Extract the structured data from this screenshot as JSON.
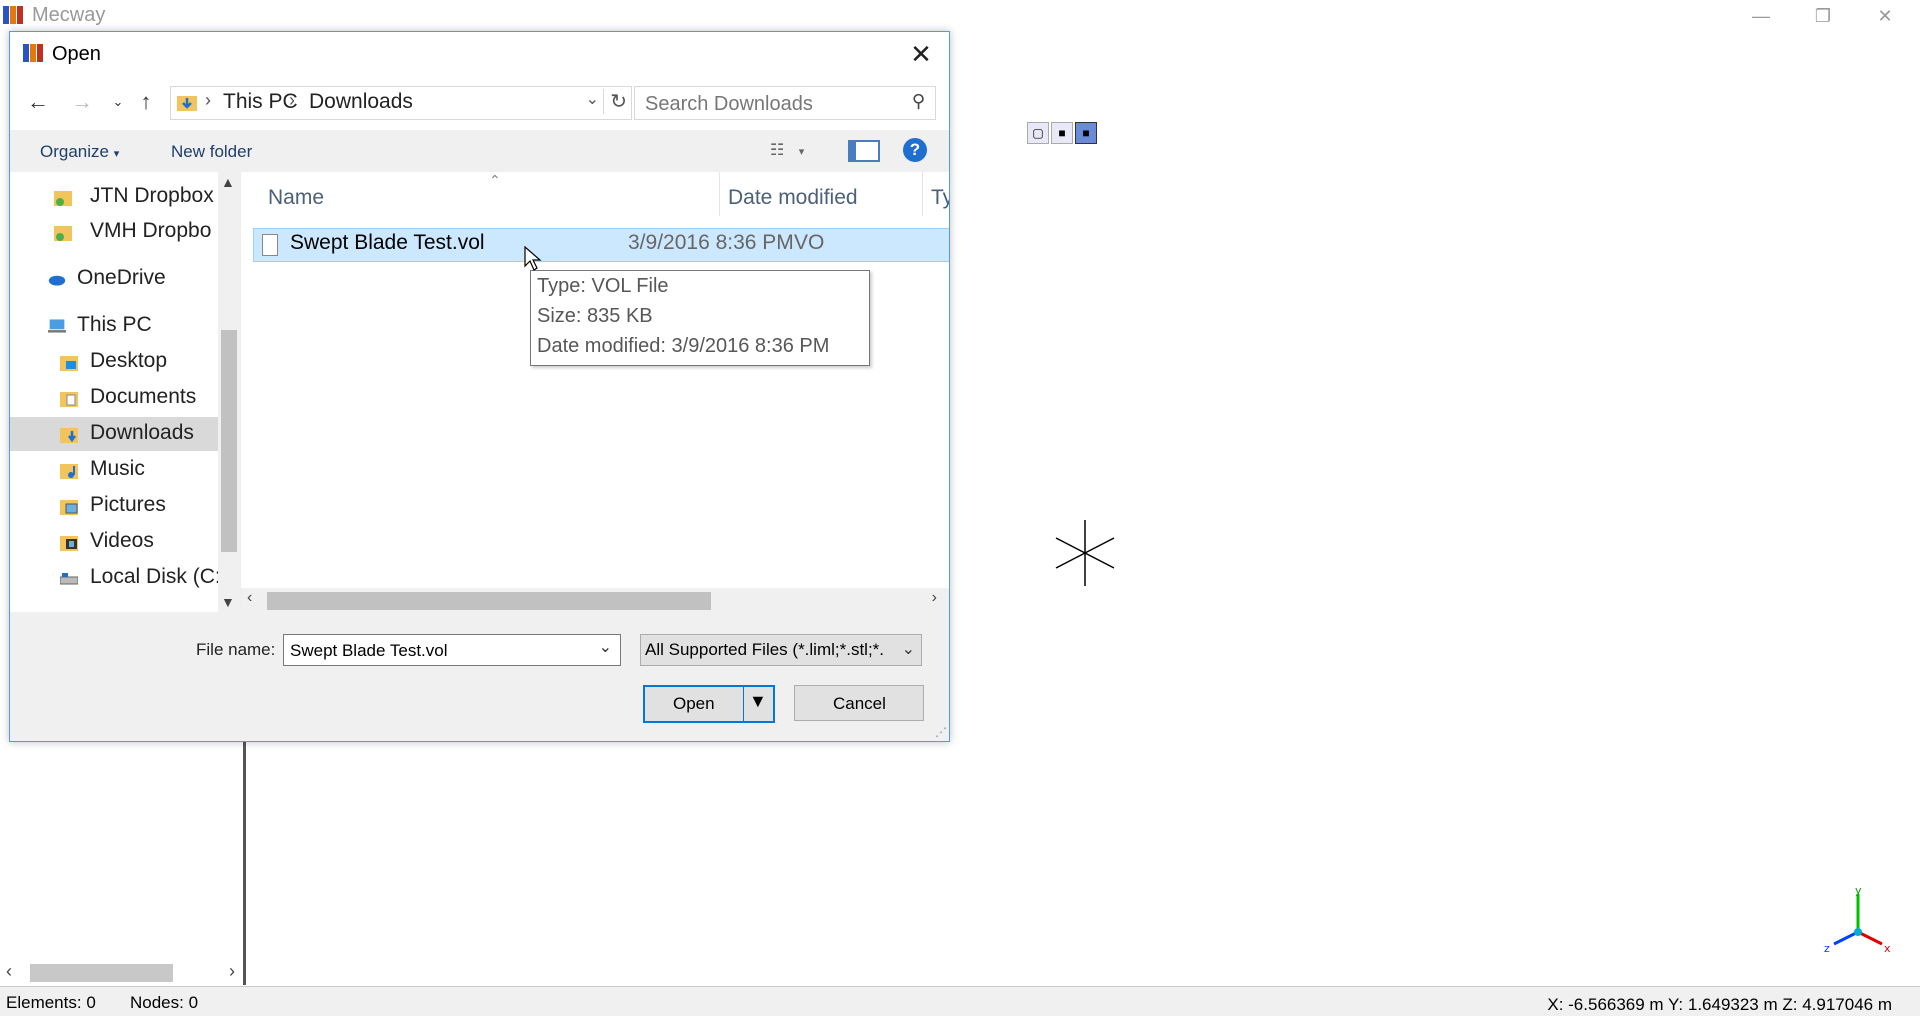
{
  "app": {
    "title": "Mecway",
    "status": {
      "elements_label": "Elements:",
      "elements_value": "0",
      "nodes_label": "Nodes:",
      "nodes_value": "0",
      "coords": "X: -6.566369 m Y: 1.649323 m Z: 4.917046 m"
    },
    "axis_labels": {
      "x": "x",
      "y": "y",
      "z": "z"
    }
  },
  "dialog": {
    "title": "Open",
    "breadcrumb": [
      "This PC",
      "Downloads"
    ],
    "search_placeholder": "Search Downloads",
    "toolbar": {
      "organize": "Organize",
      "new_folder": "New folder",
      "help": "?"
    },
    "nav_items": [
      {
        "label": "JTN Dropbox",
        "icon": "dropbox-folder-icon"
      },
      {
        "label": "VMH Dropbo",
        "icon": "dropbox-folder-icon"
      },
      {
        "label": "OneDrive",
        "icon": "onedrive-icon"
      },
      {
        "label": "This PC",
        "icon": "computer-icon"
      },
      {
        "label": "Desktop",
        "icon": "desktop-folder-icon"
      },
      {
        "label": "Documents",
        "icon": "documents-folder-icon"
      },
      {
        "label": "Downloads",
        "icon": "downloads-folder-icon"
      },
      {
        "label": "Music",
        "icon": "music-folder-icon"
      },
      {
        "label": "Pictures",
        "icon": "pictures-folder-icon"
      },
      {
        "label": "Videos",
        "icon": "videos-folder-icon"
      },
      {
        "label": "Local Disk (C:)",
        "icon": "disk-drive-icon"
      }
    ],
    "columns": {
      "name": "Name",
      "date": "Date modified",
      "type": "Typ"
    },
    "files": [
      {
        "name": "Swept Blade Test.vol",
        "date": "3/9/2016 8:36 PM",
        "type": "VO"
      }
    ],
    "tooltip": {
      "type": "Type: VOL File",
      "size": "Size: 835 KB",
      "date": "Date modified: 3/9/2016 8:36 PM"
    },
    "file_name_label": "File name:",
    "file_name_value": "Swept Blade Test.vol",
    "file_type_value": "All Supported Files (*.liml;*.stl;*.",
    "open_label": "Open",
    "cancel_label": "Cancel"
  },
  "colors": {
    "accent": "#0078d7",
    "selection": "#cce8ff",
    "help_blue": "#1e6fd0"
  }
}
